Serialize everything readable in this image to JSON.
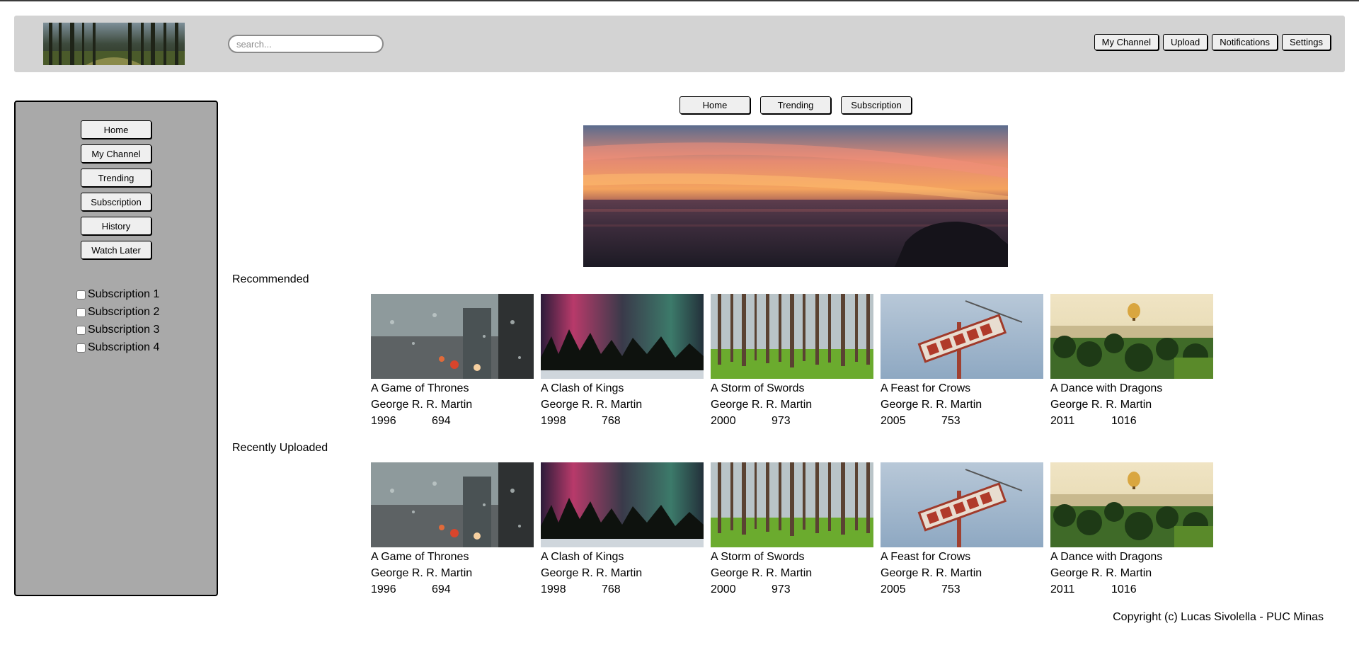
{
  "header": {
    "search_placeholder": "search...",
    "actions": [
      "My Channel",
      "Upload",
      "Notifications",
      "Settings"
    ]
  },
  "sidebar": {
    "nav": [
      "Home",
      "My Channel",
      "Trending",
      "Subscription",
      "History",
      "Watch Later"
    ],
    "subscriptions": [
      "Subscription 1",
      "Subscription 2",
      "Subscription 3",
      "Subscription 4"
    ]
  },
  "main": {
    "tabs": [
      "Home",
      "Trending",
      "Subscription"
    ],
    "sections": [
      {
        "title": "Recommended",
        "cards": [
          {
            "title": "A Game of Thrones",
            "author": "George R. R. Martin",
            "year": "1996",
            "pages": "694",
            "thumb": "rain-window"
          },
          {
            "title": "A Clash of Kings",
            "author": "George R. R. Martin",
            "year": "1998",
            "pages": "768",
            "thumb": "aurora"
          },
          {
            "title": "A Storm of Swords",
            "author": "George R. R. Martin",
            "year": "2000",
            "pages": "973",
            "thumb": "pine-forest"
          },
          {
            "title": "A Feast for Crows",
            "author": "George R. R. Martin",
            "year": "2005",
            "pages": "753",
            "thumb": "motel-sign"
          },
          {
            "title": "A Dance with Dragons",
            "author": "George R. R. Martin",
            "year": "2011",
            "pages": "1016",
            "thumb": "balloon-palms"
          }
        ]
      },
      {
        "title": "Recently Uploaded",
        "cards": [
          {
            "title": "A Game of Thrones",
            "author": "George R. R. Martin",
            "year": "1996",
            "pages": "694",
            "thumb": "rain-window"
          },
          {
            "title": "A Clash of Kings",
            "author": "George R. R. Martin",
            "year": "1998",
            "pages": "768",
            "thumb": "aurora"
          },
          {
            "title": "A Storm of Swords",
            "author": "George R. R. Martin",
            "year": "2000",
            "pages": "973",
            "thumb": "pine-forest"
          },
          {
            "title": "A Feast for Crows",
            "author": "George R. R. Martin",
            "year": "2005",
            "pages": "753",
            "thumb": "motel-sign"
          },
          {
            "title": "A Dance with Dragons",
            "author": "George R. R. Martin",
            "year": "2011",
            "pages": "1016",
            "thumb": "balloon-palms"
          }
        ]
      }
    ]
  },
  "footer": {
    "copyright": "Copyright (c) Lucas Sivolella - PUC Minas"
  },
  "colors": {
    "header_bg": "#d3d3d3",
    "sidebar_bg": "#a9a9a9",
    "button_bg": "#efefef"
  }
}
